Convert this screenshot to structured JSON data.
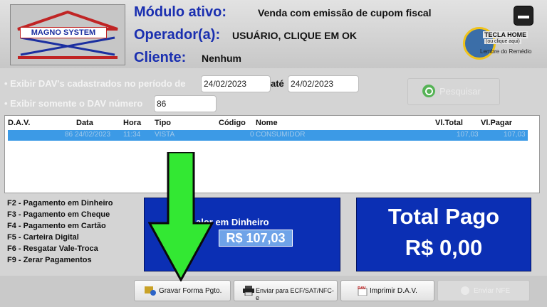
{
  "header": {
    "logo_text": "MAGNO SYSTEM",
    "module_label": "Módulo ativo:",
    "module_value": "Venda com emissão de cupom fiscal",
    "operator_label": "Operador(a):",
    "operator_value": "USUÁRIO, CLIQUE EM OK",
    "client_label": "Cliente:",
    "client_value": "Nenhum",
    "tecla_home_line1": "TECLA HOME",
    "tecla_home_line2": "(ou clique aqui)",
    "tecla_home_line3": "Lembre do Remédio"
  },
  "filters": {
    "period_label": "Exibir DAV's cadastrados no período de",
    "date_from": "24/02/2023",
    "ate_label": "até",
    "date_to": "24/02/2023",
    "dav_label": "Exibir somente o DAV número",
    "dav_number": "86",
    "search_label": "Pesquisar"
  },
  "table": {
    "columns": [
      "D.A.V.",
      "Data",
      "Hora",
      "Tipo",
      "Código",
      "Nome",
      "Vl.Total",
      "Vl.Pagar"
    ],
    "row": [
      "86",
      "24/02/2023",
      "11:34",
      "VISTA",
      "0",
      "CONSUMIDOR",
      "107,03",
      "107,03"
    ]
  },
  "shortcuts": [
    "F2 - Pagamento em Dinheiro",
    "F3 - Pagamento em Cheque",
    "F4 - Pagamento em Cartão",
    "F5 - Carteira Digital",
    "F6 - Resgatar Vale-Troca",
    "F9 - Zerar Pagamentos"
  ],
  "payment": {
    "dinheiro_label": "alor em Dinheiro",
    "dinheiro_value": "R$ 107,03",
    "total_label": "Total Pago",
    "total_value": "R$ 0,00"
  },
  "toolbar": {
    "gravar": "Gravar Forma Pgto.",
    "enviar_ecf": "Enviar para ECF/SAT/NFC-e",
    "imprimir": "Imprimir D.A.V.",
    "enviar_nfe": "Enviar NFE",
    "dav_icon_text": "DAV"
  },
  "colors": {
    "accent_blue": "#0b2fb4",
    "label_blue": "#1a2fb0",
    "selected_row": "#3c9ae6",
    "arrow_green": "#33e833"
  }
}
